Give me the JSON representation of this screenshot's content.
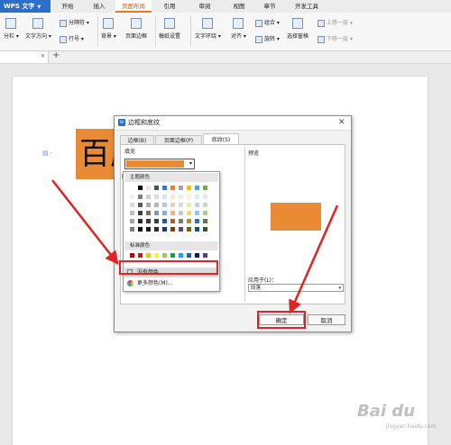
{
  "app": {
    "name": "WPS 文字"
  },
  "menu": {
    "tabs": [
      "开始",
      "插入",
      "页面布局",
      "引用",
      "审阅",
      "视图",
      "章节",
      "开发工具"
    ],
    "active_tab": "页面布局"
  },
  "ribbon": {
    "columns": "分栏",
    "text_direction": "文字方向",
    "separator": "分隔符",
    "line_number": "行号",
    "background": "背景",
    "page_border": "页面边框",
    "paper_setting": "稿纸设置",
    "text_wrap": "文字环绕",
    "align": "对齐",
    "group": "组合",
    "rotate": "旋转",
    "selection_pane": "选择窗格",
    "bring_forward": "上移一层",
    "send_backward": "下移一层"
  },
  "document": {
    "text": "百度"
  },
  "dialog": {
    "title": "边框和底纹",
    "tabs": [
      "边框(B)",
      "页面边框(P)",
      "底纹(S)"
    ],
    "active_tab": "底纹(S)",
    "fill_label": "填充",
    "fill_color": "#e98a35",
    "pattern_label": "图",
    "preview_label": "预览",
    "apply_to_label": "应用于(L)：",
    "apply_to_value": "段落",
    "ok": "确定",
    "cancel": "取消",
    "dropdown": {
      "theme_colors_label": "主题颜色",
      "theme_top": [
        "#ffffff",
        "#000000",
        "#e7e6e6",
        "#44546a",
        "#4472c4",
        "#ed7d31",
        "#a5a5a5",
        "#ffc000",
        "#5b9bd5",
        "#70ad47"
      ],
      "theme_shades": [
        [
          "#f2f2f2",
          "#7f7f7f",
          "#d0cece",
          "#d6dce4",
          "#d9e2f3",
          "#fbe5d5",
          "#ededed",
          "#fff2cc",
          "#deebf6",
          "#e2efd9"
        ],
        [
          "#d8d8d8",
          "#595959",
          "#aeabab",
          "#adb9ca",
          "#b4c6e7",
          "#f7cbac",
          "#dbdbdb",
          "#fee599",
          "#bdd7ee",
          "#c5e0b3"
        ],
        [
          "#bfbfbf",
          "#3f3f3f",
          "#757070",
          "#8496b0",
          "#8eaadb",
          "#f4b183",
          "#c9c9c9",
          "#ffd965",
          "#9dc3e6",
          "#a8d08d"
        ],
        [
          "#a5a5a5",
          "#262626",
          "#3a3838",
          "#323f4f",
          "#2f5496",
          "#c55a11",
          "#7b7b7b",
          "#bf8f00",
          "#2e75b5",
          "#538135"
        ],
        [
          "#7f7f7f",
          "#0c0c0c",
          "#171616",
          "#222a35",
          "#1f3864",
          "#833c0b",
          "#525252",
          "#7f6000",
          "#1e4e79",
          "#375623"
        ]
      ],
      "standard_colors_label": "标准颜色",
      "standard": [
        "#c00000",
        "#ff0000",
        "#ffc000",
        "#ffff00",
        "#92d050",
        "#00b050",
        "#00b0f0",
        "#0070c0",
        "#002060",
        "#7030a0"
      ],
      "no_color": "没有颜色",
      "more_colors": "更多颜色(M)..."
    }
  },
  "annotation": {
    "highlight_color": "#e02424"
  },
  "watermark": {
    "brand": "Bai du",
    "site": "jingyan.baidu.com"
  }
}
